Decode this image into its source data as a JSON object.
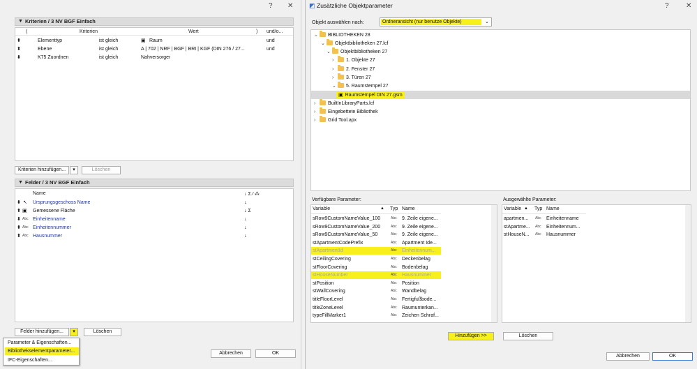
{
  "left": {
    "win_help": "?",
    "win_close": "✕",
    "criteria": {
      "title": "Kriterien / 3 NV BGF Einfach",
      "headers": [
        "(",
        "Kriterien",
        "Wert",
        ")",
        "und/o..."
      ],
      "rows": [
        {
          "criterion": "Elementtyp",
          "op": "ist gleich",
          "value": "Raum",
          "conj": "und"
        },
        {
          "criterion": "Ebene",
          "op": "ist gleich",
          "value": "A | 702 | NRF | BGF | BRI | KGF (DIN 276 / 27...",
          "conj": "und"
        },
        {
          "criterion": "K75 Zuordnen",
          "op": "ist gleich",
          "value": "Nahversorger",
          "conj": ""
        }
      ],
      "add_button": "Kriterien hinzufügen...",
      "delete_button": "Löschen"
    },
    "fields": {
      "title": "Felder / 3 NV BGF Einfach",
      "header_name": "Name",
      "header_icons": "↓ Σ ⁄ ⁂",
      "rows": [
        {
          "icon": "cursor",
          "name": "Ursprungsgeschoss Name",
          "flags": "↓"
        },
        {
          "icon": "area",
          "name": "Gemessene Fläche",
          "flags": "↓ Σ"
        },
        {
          "icon": "Abc",
          "name": "Einheitenname",
          "flags": "↓"
        },
        {
          "icon": "Abc",
          "name": "Einheitennummer",
          "flags": "↓"
        },
        {
          "icon": "Abc",
          "name": "Hausnummer",
          "flags": "↓"
        }
      ],
      "add_button": "Felder hinzufügen...",
      "delete_button": "Löschen"
    },
    "menu": [
      "Parameter & Eigenschaften...",
      "Bibliothekselementparameter...",
      "IFC-Eigenschaften..."
    ],
    "cancel": "Abbrechen",
    "ok": "OK"
  },
  "right": {
    "title": "Zusätzliche Objektparameter",
    "win_help": "?",
    "win_close": "✕",
    "select_label": "Objekt auswählen nach:",
    "select_value": "Ordneransicht (nur benutze Objekte)",
    "tree": [
      {
        "level": 0,
        "label": "BIBLIOTHEKEN 28",
        "chev": "⌄"
      },
      {
        "level": 1,
        "label": "Objektbibliotheken 27.lcf",
        "chev": "⌄"
      },
      {
        "level": 2,
        "label": "Objektbibliotheken 27",
        "chev": "⌄"
      },
      {
        "level": 3,
        "label": "1. Objekte 27",
        "chev": "›"
      },
      {
        "level": 3,
        "label": "2. Fenster 27",
        "chev": "›"
      },
      {
        "level": 3,
        "label": "3. Türen 27",
        "chev": "›"
      },
      {
        "level": 3,
        "label": "5. Raumstempel 27",
        "chev": "⌄"
      },
      {
        "level": 4,
        "label": "Raumstempel DIN 27.gsm",
        "chev": ""
      },
      {
        "level": 0,
        "label": "BuiltInLibraryParts.lcf",
        "chev": "›"
      },
      {
        "level": 0,
        "label": "Eingebettete Bibliothek",
        "chev": "›"
      },
      {
        "level": 0,
        "label": "Grid Tool.apx",
        "chev": "›"
      }
    ],
    "available_label": "Verfügbare Parameter:",
    "selected_label": "Ausgewählte Parameter:",
    "col_variable": "Variable",
    "col_typ": "Typ",
    "col_name": "Name",
    "available": [
      {
        "var": "sRow9CustomNameValue_100",
        "name": "9. Zeile eigene...",
        "state": "normal"
      },
      {
        "var": "sRow9CustomNameValue_200",
        "name": "9. Zeile eigene...",
        "state": "normal"
      },
      {
        "var": "sRow9CustomNameValue_50",
        "name": "9. Zeile eigene...",
        "state": "normal"
      },
      {
        "var": "stApartmentCodePrefix",
        "name": "Apartment Ide...",
        "state": "normal"
      },
      {
        "var": "stApartmentId",
        "name": "Einheitennum...",
        "state": "used"
      },
      {
        "var": "stCeilingCovering",
        "name": "Deckenbelag",
        "state": "normal"
      },
      {
        "var": "stFloorCovering",
        "name": "Bodenbelag",
        "state": "normal"
      },
      {
        "var": "stHouseNumber",
        "name": "Hausnummer",
        "state": "used"
      },
      {
        "var": "stPosition",
        "name": "Position",
        "state": "normal"
      },
      {
        "var": "stWallCovering",
        "name": "Wandbelag",
        "state": "normal"
      },
      {
        "var": "titleFloorLevel",
        "name": "Fertigfußbode...",
        "state": "normal"
      },
      {
        "var": "titleZoneLevel",
        "name": "Raumunterkan...",
        "state": "normal"
      },
      {
        "var": "typeFillMarker1",
        "name": "Zeichen Schraf...",
        "state": "normal"
      }
    ],
    "selected": [
      {
        "var": "apartmen...",
        "name": "Einheitenname"
      },
      {
        "var": "stApartme...",
        "name": "Einheitennum..."
      },
      {
        "var": "stHouseN...",
        "name": "Hausnummer"
      }
    ],
    "typ_abc": "Abc",
    "add_button": "Hinzufügen >>",
    "delete_button": "Löschen",
    "cancel": "Abbrechen",
    "ok": "OK"
  }
}
